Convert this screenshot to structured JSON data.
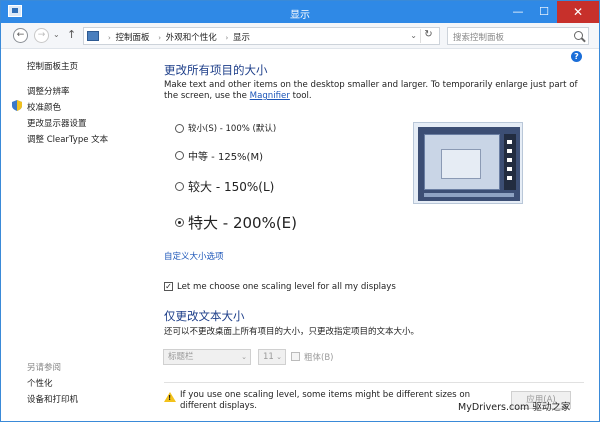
{
  "window": {
    "title": "显示",
    "minimize": "—",
    "maximize": "☐",
    "close": "✕"
  },
  "nav": {
    "back": "←",
    "forward": "→",
    "dropdown": "⌄",
    "up": "↑",
    "breadcrumbs": [
      "控制面板",
      "外观和个性化",
      "显示"
    ],
    "crumb_separator": "›",
    "address_dropdown": "⌄",
    "refresh": "↻",
    "search_placeholder": "搜索控制面板"
  },
  "help": "?",
  "sidebar": {
    "home": "控制面板主页",
    "items": [
      "调整分辨率",
      "校准颜色",
      "更改显示器设置",
      "调整 ClearType 文本"
    ],
    "see_also_title": "另请参阅",
    "see_also": [
      "个性化",
      "设备和打印机"
    ]
  },
  "main": {
    "heading": "更改所有项目的大小",
    "description_before": "Make text and other items on the desktop smaller and larger. To temporarily enlarge just part of the screen, use the ",
    "description_link": "Magnifier",
    "description_after": " tool.",
    "options": [
      {
        "label": "较小(S) - 100% (默认)",
        "checked": false
      },
      {
        "label": "中等 - 125%(M)",
        "checked": false
      },
      {
        "label": "较大 - 150%(L)",
        "checked": false
      },
      {
        "label": "特大 - 200%(E)",
        "checked": true
      }
    ],
    "custom_link": "自定义大小选项",
    "checkbox": {
      "checked": true,
      "mark": "✓",
      "label": "Let me choose one scaling level for all my displays"
    },
    "heading2": "仅更改文本大小",
    "description2": "还可以不更改桌面上所有项目的大小，只更改指定项目的文本大小。",
    "item_select": "标题栏",
    "size_select": "11",
    "select_arrow": "⌄",
    "bold_label": "粗体(B)",
    "warning": "If you use one scaling level, some items might be different sizes on different displays.",
    "warning_mark": "!",
    "apply_button": "应用(A)"
  },
  "watermark": "MyDrivers.com 驱动之家"
}
